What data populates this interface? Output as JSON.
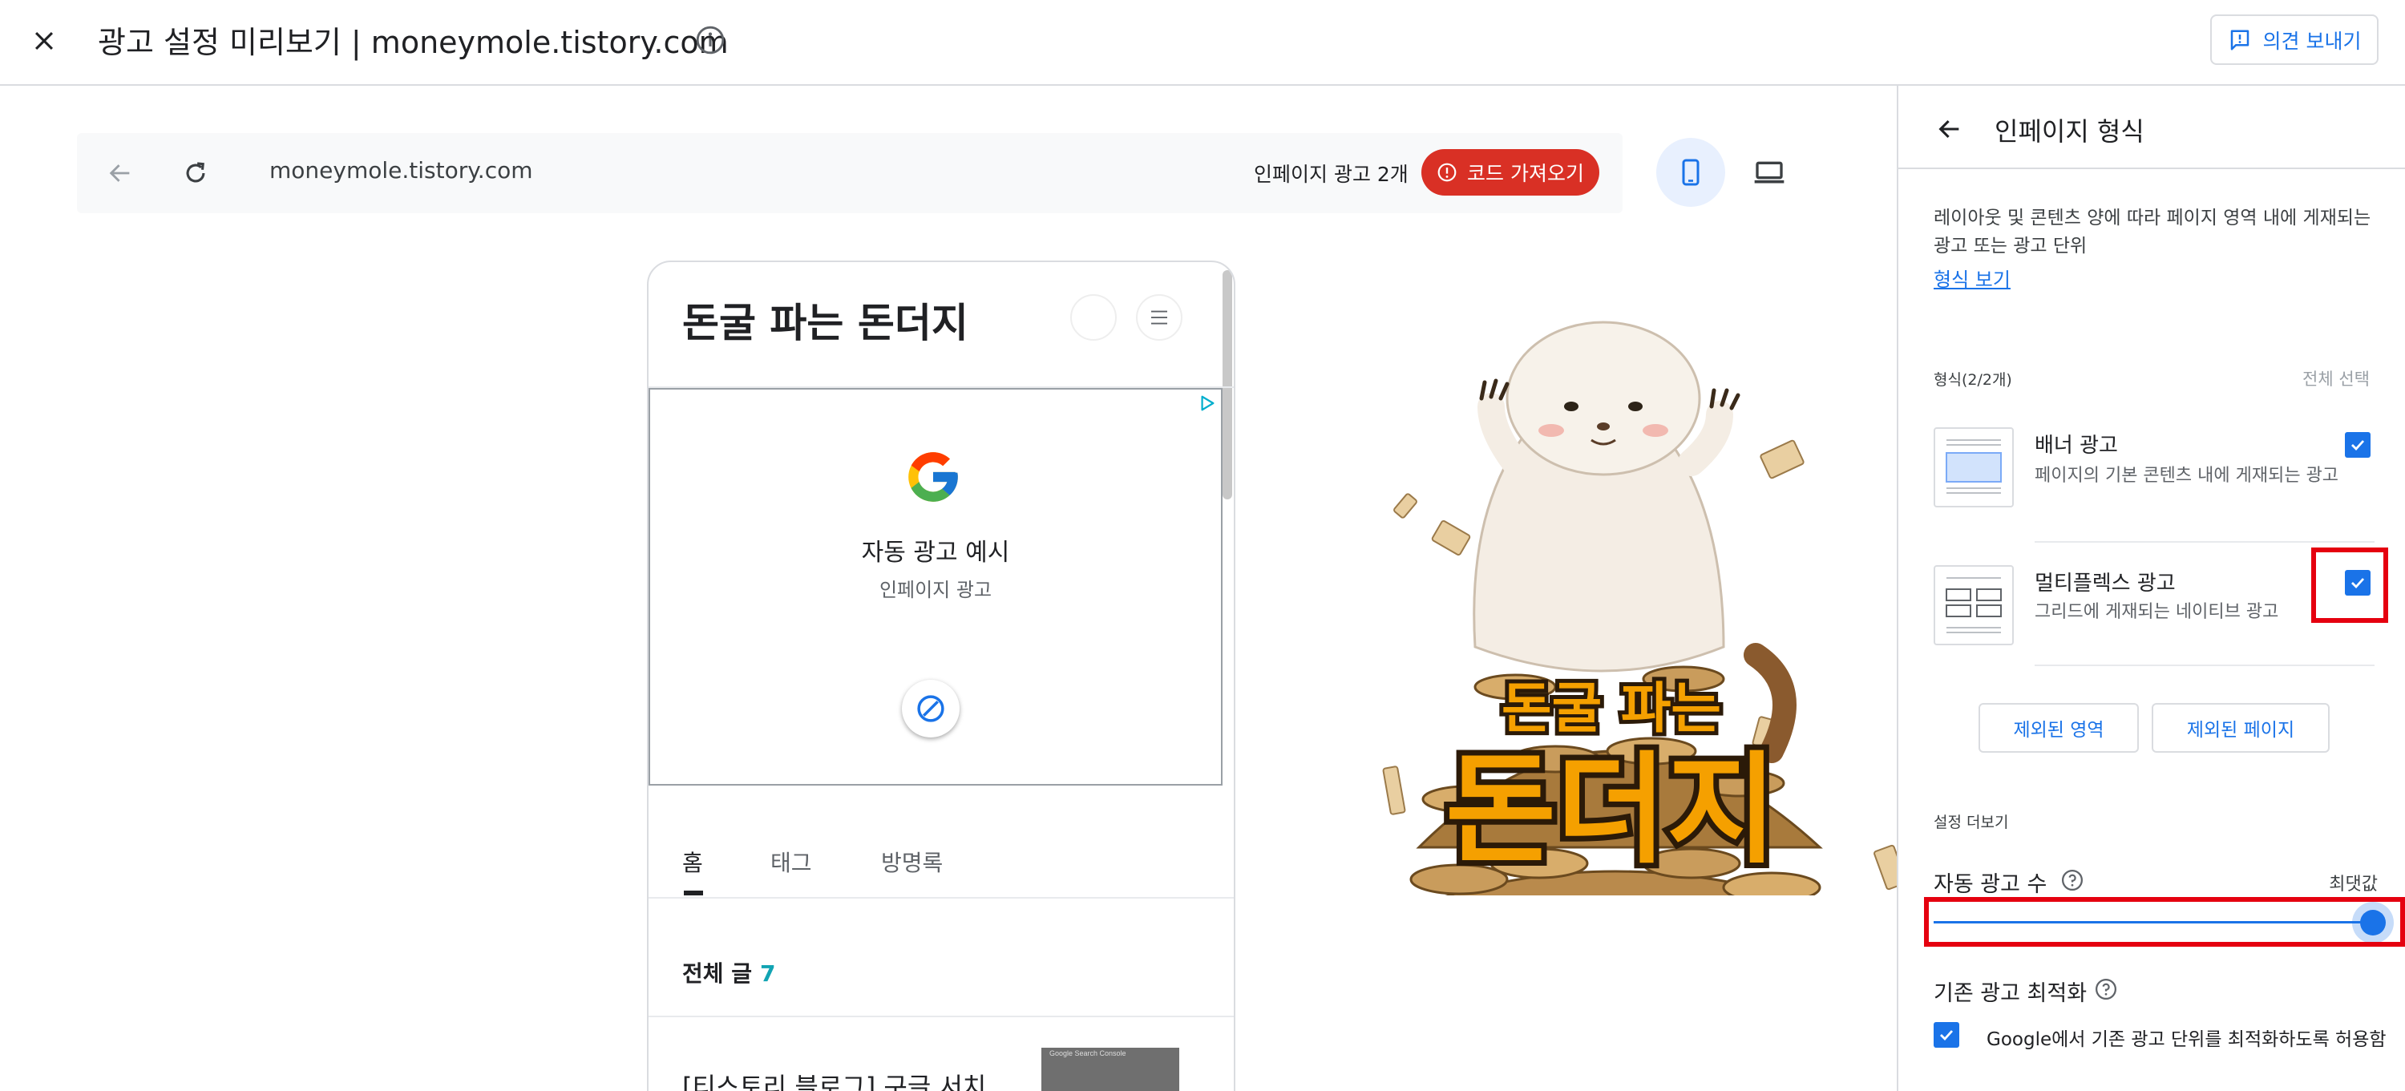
{
  "header": {
    "title": "광고 설정 미리보기 | moneymole.tistory.com",
    "feedback_label": "의견 보내기"
  },
  "preview": {
    "url": "moneymole.tistory.com",
    "inpage_ad_count": "인페이지 광고 2개",
    "get_code_label": "코드 가져오기",
    "blog": {
      "title": "돈굴 파는 돈더지",
      "ad": {
        "title": "자동 광고 예시",
        "subtitle": "인페이지 광고"
      },
      "tabs": [
        "홈",
        "태그",
        "방명록"
      ],
      "all_posts_label": "전체 글",
      "all_posts_count": "7",
      "post_title": "[티스토리 블로그] 구글 서치...",
      "thumb_caption": "Google Search Console"
    },
    "illustration": {
      "line1": "돈굴 파는",
      "line2": "돈더지"
    }
  },
  "panel": {
    "title": "인페이지 형식",
    "description": "레이아웃 및 콘텐츠 양에 따라 페이지 영역 내에 게재되는 광고 또는 광고 단위",
    "view_format_link": "형식 보기",
    "formats_label": "형식(2/2개)",
    "select_all": "전체 선택",
    "formats": [
      {
        "name": "배너 광고",
        "desc": "페이지의 기본 콘텐츠 내에 게재되는 광고",
        "checked": true
      },
      {
        "name": "멀티플렉스 광고",
        "desc": "그리드에 게재되는 네이티브 광고",
        "checked": true
      }
    ],
    "excluded_areas": "제외된 영역",
    "excluded_pages": "제외된 페이지",
    "more_settings": "설정 더보기",
    "ad_count_label": "자동 광고 수",
    "ad_count_max": "최댓값",
    "ad_count_level": 1.0,
    "optimize_label": "기존 광고 최적화",
    "optimize_check_label": "Google에서 기존 광고 단위를 최적화하도록 허용함",
    "optimize_checked": true
  },
  "colors": {
    "accent": "#1a73e8",
    "code_button": "#d93025",
    "highlight": "#e5000f",
    "illustration_text": "#f5a000"
  },
  "icons": [
    "close-icon",
    "info-icon",
    "feedback-icon",
    "back-arrow-icon",
    "reload-icon",
    "error-icon",
    "mobile-icon",
    "desktop-icon",
    "menu-icon",
    "adchoices-icon",
    "google-logo-icon",
    "block-icon",
    "help-icon",
    "check-icon"
  ]
}
